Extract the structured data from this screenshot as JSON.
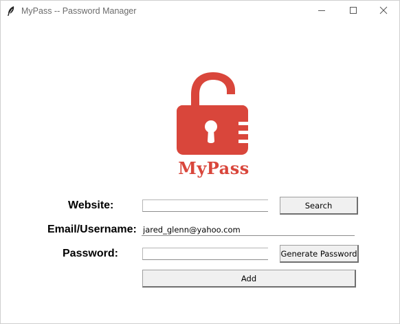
{
  "window": {
    "title": "MyPass -- Password Manager",
    "icon": "feather-icon",
    "controls": [
      "minimize-icon",
      "maximize-icon",
      "close-icon"
    ]
  },
  "logo": {
    "icon": "open-padlock-icon",
    "text": "MyPass",
    "color": "#d9463b"
  },
  "form": {
    "website_label": "Website:",
    "website_value": "",
    "email_label": "Email/Username:",
    "email_value": "jared_glenn@yahoo.com",
    "password_label": "Password:",
    "password_value": ""
  },
  "buttons": {
    "search": "Search",
    "generate": "Generate Password",
    "add": "Add"
  }
}
